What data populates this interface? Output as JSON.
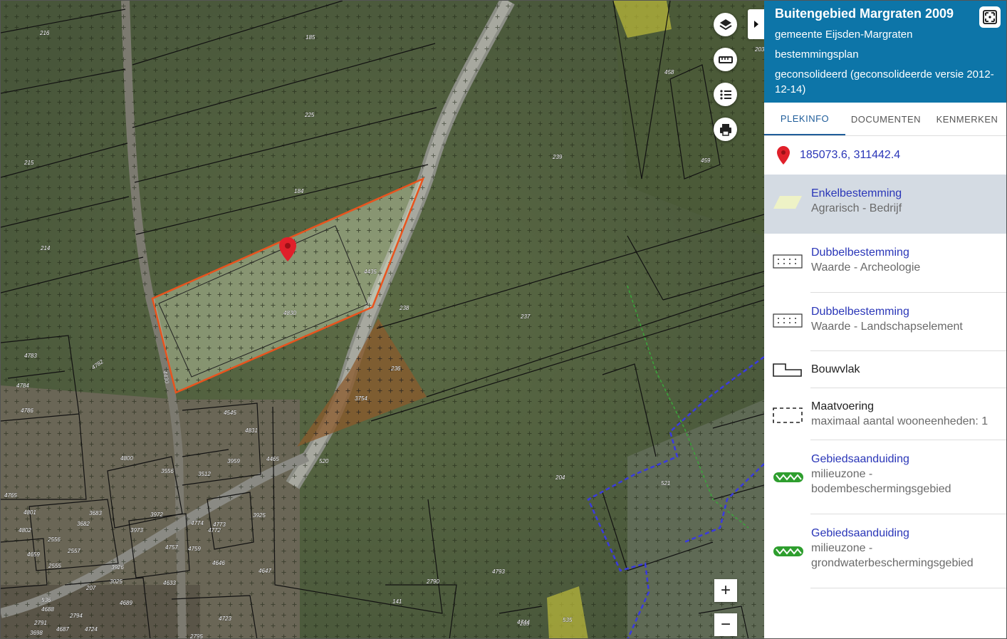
{
  "panel": {
    "title": "Buitengebied Margraten 2009",
    "municipality": "gemeente Eijsden-Margraten",
    "plan_type": "bestemmingsplan",
    "status": "geconsolideerd (geconsolideerde versie 2012-12-14)"
  },
  "tabs": [
    {
      "label": "PLEKINFO",
      "active": true
    },
    {
      "label": "DOCUMENTEN",
      "active": false
    },
    {
      "label": "KENMERKEN",
      "active": false
    }
  ],
  "location": {
    "coordinates": "185073.6, 311442.4",
    "icon": "map-pin-icon"
  },
  "legend": [
    {
      "title": "Enkelbestemming",
      "subtitle": "Agrarisch - Bedrijf",
      "symbol": "pale-yellow-parallelogram",
      "selected": true
    },
    {
      "title": "Dubbelbestemming",
      "subtitle": "Waarde - Archeologie",
      "symbol": "dotted-grid"
    },
    {
      "title": "Dubbelbestemming",
      "subtitle": "Waarde - Landschapselement",
      "symbol": "dotted-grid"
    },
    {
      "title": "Bouwvlak",
      "subtitle": "",
      "symbol": "building-outline"
    },
    {
      "title": "Maatvoering",
      "subtitle": "maximaal aantal wooneenheden: 1",
      "symbol": "dashed-rectangle"
    },
    {
      "title": "Gebiedsaanduiding",
      "subtitle": "milieuzone - bodembeschermingsgebied",
      "symbol": "green-zigzag"
    },
    {
      "title": "Gebiedsaanduiding",
      "subtitle": "milieuzone - grondwaterbeschermingsgebied",
      "symbol": "green-zigzag"
    }
  ],
  "map": {
    "controls": {
      "zoom_in": "+",
      "zoom_out": "−"
    },
    "tools": [
      "layers-icon",
      "ruler-icon",
      "list-icon",
      "print-icon"
    ],
    "parcel_labels": [
      "216",
      "185",
      "225",
      "215",
      "184",
      "214",
      "239",
      "458",
      "459",
      "4435",
      "4830",
      "238",
      "237",
      "236",
      "3754",
      "4783",
      "4782",
      "4430",
      "4784",
      "4786",
      "4545",
      "4831",
      "3959",
      "4465",
      "520",
      "4800",
      "3556",
      "3512",
      "4765",
      "4801",
      "3683",
      "3682",
      "3972",
      "4802",
      "3973",
      "4774",
      "4773",
      "4772",
      "3925",
      "2556",
      "2557",
      "4757",
      "4759",
      "4659",
      "2555",
      "4646",
      "3926",
      "3025",
      "4633",
      "4647",
      "207",
      "2790",
      "141",
      "4793",
      "536",
      "4688",
      "4689",
      "2794",
      "2791",
      "4687",
      "4724",
      "3698",
      "4723",
      "2795",
      "4744",
      "205",
      "535",
      "204",
      "521",
      "203",
      "471"
    ],
    "colors": {
      "accent_blue": "#0d75a8",
      "link_blue": "#2a36b8",
      "plot_outline": "#e8541e",
      "bodem_zone": "#3a3adf",
      "zigzag_green": "#2e9e2e"
    }
  }
}
